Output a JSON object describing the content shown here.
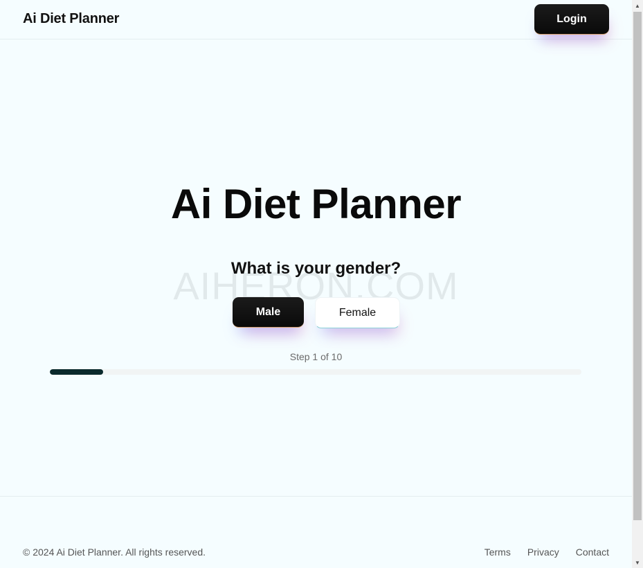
{
  "header": {
    "brand": "Ai Diet Planner",
    "login_label": "Login"
  },
  "hero": {
    "title": "Ai Diet Planner",
    "question": "What is your gender?",
    "watermark": "AIHERON.COM",
    "options": [
      {
        "label": "Male",
        "selected": true
      },
      {
        "label": "Female",
        "selected": false
      }
    ],
    "step_label": "Step 1 of 10",
    "progress": {
      "current": 1,
      "total": 10
    }
  },
  "footer": {
    "copyright": "© 2024 Ai Diet Planner. All rights reserved.",
    "links": [
      "Terms",
      "Privacy",
      "Contact"
    ]
  },
  "colors": {
    "background": "#f5fdff",
    "button_dark": "#0a0a0a",
    "progress_fill": "#0b2a2c",
    "progress_track": "#f1f4f4"
  },
  "icons": {
    "scroll_up": "triangle-up",
    "scroll_down": "triangle-down"
  }
}
